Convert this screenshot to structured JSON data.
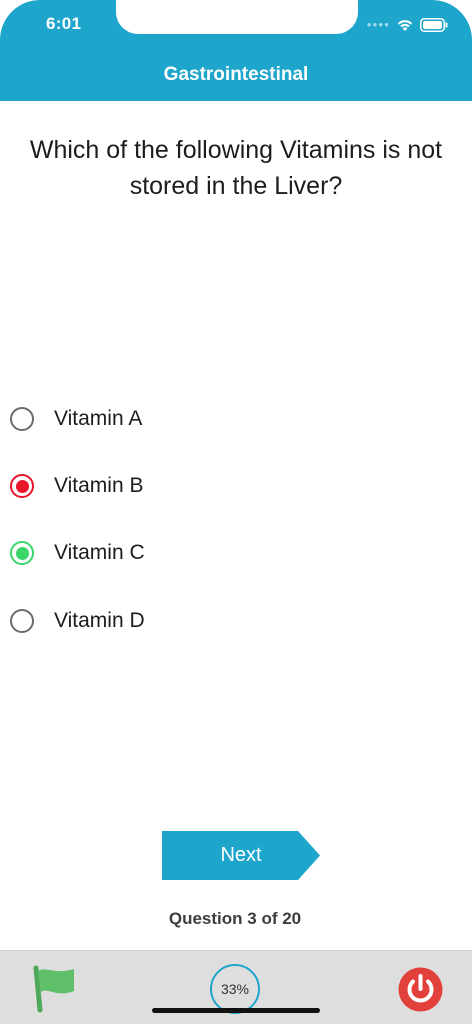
{
  "status_bar": {
    "time": "6:01"
  },
  "header": {
    "title": "Gastrointestinal",
    "color": "#1ea5cc"
  },
  "question": {
    "line1": "Which of the following Vitamins is not",
    "line2": "stored in the Liver?"
  },
  "options": [
    {
      "label": "Vitamin A",
      "state": "unselected"
    },
    {
      "label": "Vitamin B",
      "state": "wrong",
      "color": "#e8152b"
    },
    {
      "label": "Vitamin C",
      "state": "correct",
      "color": "#3ad66a"
    },
    {
      "label": "Vitamin D",
      "state": "unselected"
    }
  ],
  "next_button": {
    "label": "Next",
    "color": "#1ea5cc"
  },
  "progress": {
    "question_label": "Question 3 of 20",
    "percent_label": "33%",
    "fraction": 0.33
  },
  "toolbar": {
    "flag_icon": "flag-icon",
    "flag_color": "#5fbf6a",
    "power_icon": "power-icon",
    "power_color": "#e2403a"
  }
}
